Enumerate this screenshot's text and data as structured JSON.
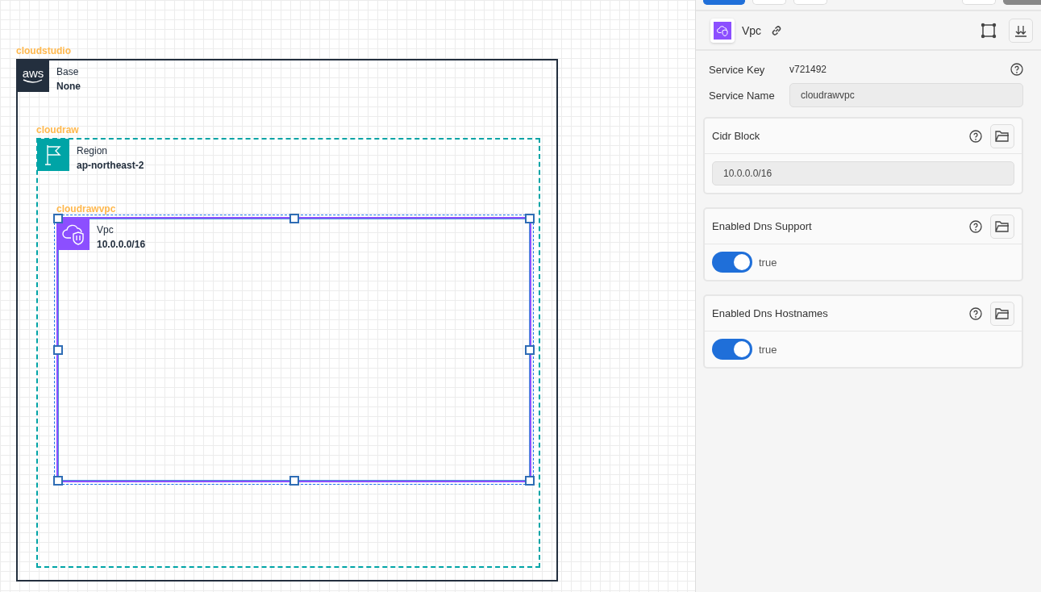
{
  "canvas": {
    "groups": [
      {
        "kind": "cloud",
        "label": "cloudstudio",
        "logo_text": "aws",
        "type_label": "Base",
        "value": "None",
        "selected": false,
        "children": [
          {
            "kind": "region",
            "label": "cloudraw",
            "type_label": "Region",
            "value": "ap-northeast-2",
            "selected": false,
            "children": [
              {
                "kind": "vpc",
                "label": "cloudrawvpc",
                "type_label": "Vpc",
                "value": "10.0.0.0/16",
                "selected": true
              }
            ]
          }
        ]
      }
    ]
  },
  "panel": {
    "header": {
      "title": "Vpc"
    },
    "service_key": {
      "label": "Service Key",
      "value": "v721492"
    },
    "service_name": {
      "label": "Service Name",
      "value": "cloudrawvpc"
    },
    "properties": [
      {
        "kind": "text",
        "label": "Cidr Block",
        "value": "10.0.0.0/16"
      },
      {
        "kind": "toggle",
        "label": "Enabled Dns Support",
        "on": true,
        "value": "true"
      },
      {
        "kind": "toggle",
        "label": "Enabled Dns Hostnames",
        "on": true,
        "value": "true"
      }
    ]
  }
}
